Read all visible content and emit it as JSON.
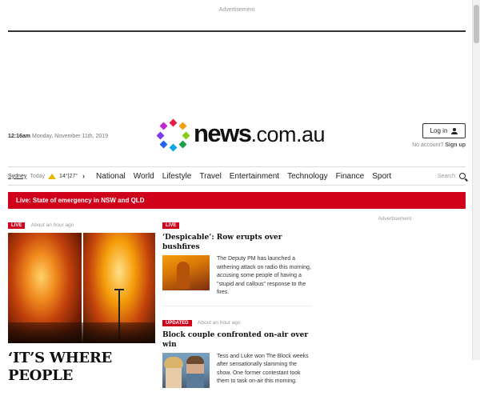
{
  "ad": {
    "top_label": "Advertisement",
    "side_label": "Advertisement"
  },
  "header": {
    "time": "12:16am",
    "date": "Monday, November 11th, 2019",
    "logo": {
      "brand": "news",
      "domain": ".com.au"
    },
    "login_label": "Log in",
    "no_account_text": "No account?",
    "signup_label": "Sign up"
  },
  "nav": {
    "weather": {
      "city": "Sydney",
      "day": "Today",
      "temps": "14°|27°"
    },
    "links": [
      "National",
      "World",
      "Lifestyle",
      "Travel",
      "Entertainment",
      "Technology",
      "Finance",
      "Sport"
    ],
    "search_label": "Search"
  },
  "live_banner": "Live: State of emergency in NSW and QLD",
  "hero": {
    "badge": "LIVE",
    "time": "About an hour ago",
    "headline": "‘IT’S WHERE PEOPLE"
  },
  "stories": [
    {
      "badge": "LIVE",
      "time": "",
      "title": "‘Despicable’: Row erupts over bushfires",
      "body": "The Deputy PM has launched a withering attack on radio this morning, accusing some people of having a \"stupid and callous\" response to the fires."
    },
    {
      "badge": "UPDATED",
      "time": "About an hour ago",
      "title": "Block couple confronted on-air over win",
      "body": "Tess and Luke won The Block weeks after sensationally slamming the show. One former contestant took them to task on-air this morning."
    }
  ],
  "colors": {
    "live_red": "#d0021b",
    "text": "#222222",
    "muted": "#999999"
  },
  "icons": {
    "login": "user-icon",
    "search": "search-icon",
    "weather": "sun-icon",
    "nav_more": "chevron-right-icon"
  }
}
